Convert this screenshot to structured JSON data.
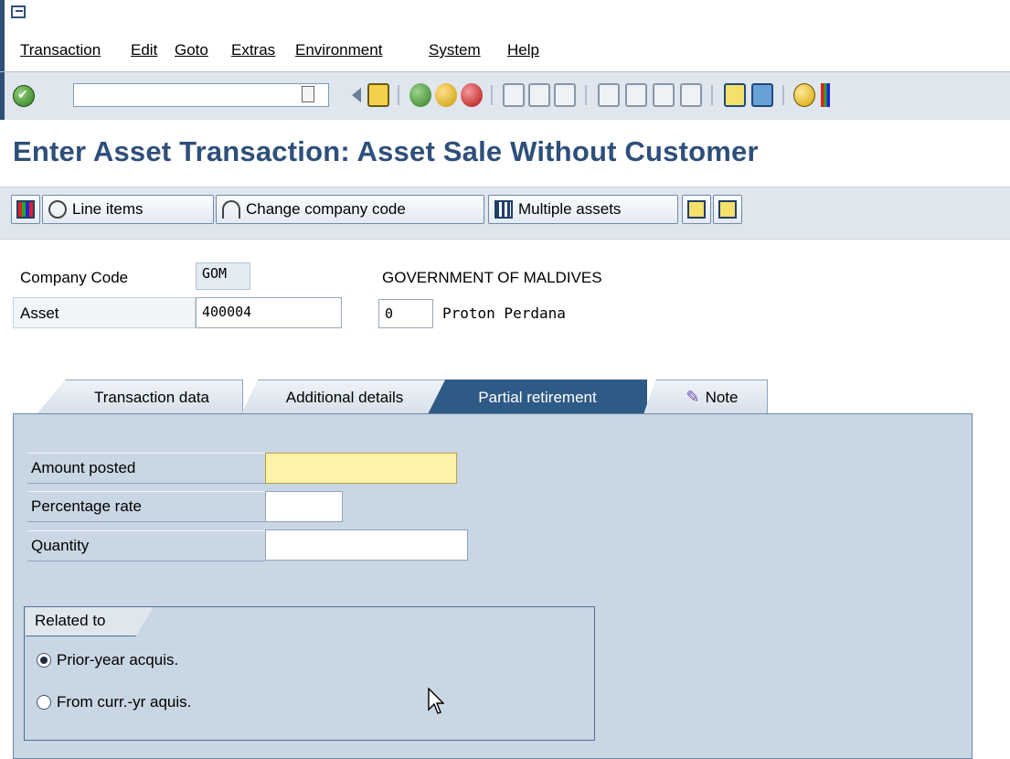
{
  "menu": {
    "items": [
      "Transaction",
      "Edit",
      "Goto",
      "Extras",
      "Environment",
      "System",
      "Help"
    ]
  },
  "toolbar": {
    "command_value": "",
    "icons": [
      "enter-icon",
      "back-arrow-icon",
      "save-icon",
      "back-icon",
      "exit-icon",
      "cancel-icon",
      "print-icon",
      "find-icon",
      "find-next-icon",
      "first-page-icon",
      "previous-page-icon",
      "next-page-icon",
      "last-page-icon",
      "create-session-icon",
      "shortcut-icon",
      "help-icon",
      "layout-menu-icon"
    ]
  },
  "page": {
    "title": "Enter Asset Transaction: Asset Sale Without Customer"
  },
  "app_toolbar": {
    "line_items": "Line items",
    "change_company_code": "Change company code",
    "multiple_assets": "Multiple assets"
  },
  "header": {
    "company_code_label": "Company Code",
    "company_code_value": "GOM",
    "company_name": "GOVERNMENT OF MALDIVES",
    "asset_label": "Asset",
    "asset_value": "400004",
    "sub_number": "0",
    "asset_description": "Proton Perdana"
  },
  "tabs": [
    {
      "label": "Transaction data"
    },
    {
      "label": "Additional details"
    },
    {
      "label": "Partial retirement"
    },
    {
      "label": "Note"
    }
  ],
  "partial_retirement": {
    "amount_posted_label": "Amount posted",
    "amount_posted_value": "",
    "percentage_rate_label": "Percentage rate",
    "percentage_rate_value": "",
    "quantity_label": "Quantity",
    "quantity_value": "",
    "related_to_title": "Related to",
    "prior_year_label": "Prior-year acquis.",
    "current_year_label": "From curr.-yr aquis.",
    "selected": "prior-year"
  },
  "colors": {
    "title_blue": "#2e4f7a",
    "panel_bg": "#c9d6e3",
    "active_tab": "#2e5a86",
    "required_field": "#fff1a8"
  }
}
